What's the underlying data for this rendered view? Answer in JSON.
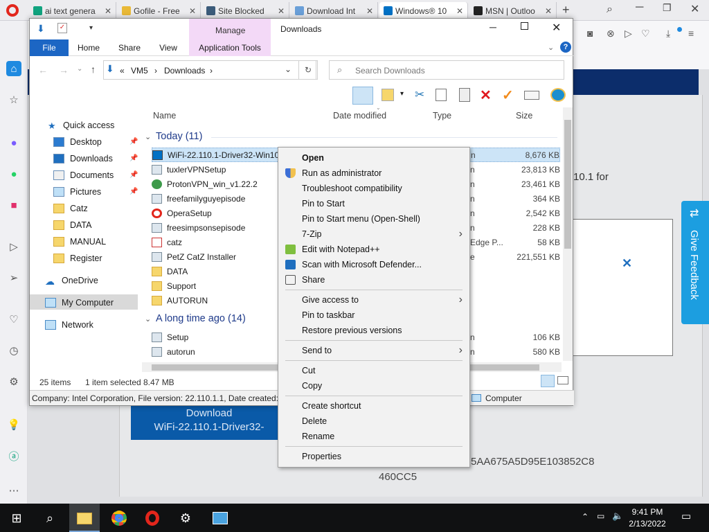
{
  "browser": {
    "tabs": [
      {
        "title": "ai text genera",
        "fav": "#11a37f"
      },
      {
        "title": "Gofile - Free",
        "fav": "#e9b937"
      },
      {
        "title": "Site Blocked",
        "fav": "#3b5b7a"
      },
      {
        "title": "Download Int",
        "fav": "#6a9fd8"
      },
      {
        "title": "Windows® 10",
        "fav": "#0071c5"
      },
      {
        "title": "MSN | Outloo",
        "fav": "#222222"
      }
    ],
    "new_tab": "+"
  },
  "page": {
    "version_frag": "10.1 for",
    "download_line1": "Download",
    "download_line2": "WiFi-22.110.1-Driver32-",
    "hash_line1": "5AA675A5D95E103852C8",
    "hash_line2": "460CC5",
    "feedback": "Give Feedback",
    "modal_close": "✕"
  },
  "explorer": {
    "title": "Downloads",
    "manage": "Manage",
    "tabs": {
      "file": "File",
      "home": "Home",
      "share": "Share",
      "view": "View",
      "app_tools": "Application Tools"
    },
    "breadcrumb": {
      "sep": "«",
      "vm": "VM5",
      "folder": "Downloads"
    },
    "search_placeholder": "Search Downloads",
    "columns": {
      "name": "Name",
      "date": "Date modified",
      "type": "Type",
      "size": "Size"
    },
    "nav": {
      "quick_access": "Quick access",
      "items": [
        "Desktop",
        "Downloads",
        "Documents",
        "Pictures",
        "Catz",
        "DATA",
        "MANUAL",
        "Register"
      ],
      "onedrive": "OneDrive",
      "computer": "My Computer",
      "network": "Network"
    },
    "groups": {
      "today": "Today (11)",
      "longago": "A long time ago (14)"
    },
    "files": [
      {
        "name": "WiFi-22.110.1-Driver32-Win10",
        "type": "n",
        "size": "8,676 KB"
      },
      {
        "name": "tuxlerVPNSetup",
        "type": "n",
        "size": "23,813 KB"
      },
      {
        "name": "ProtonVPN_win_v1.22.2",
        "type": "n",
        "size": "23,461 KB"
      },
      {
        "name": "freefamilyguyepisode",
        "type": "n",
        "size": "364 KB"
      },
      {
        "name": "OperaSetup",
        "type": "n",
        "size": "2,542 KB"
      },
      {
        "name": "freesimpsonsepisode",
        "type": "n",
        "size": "228 KB"
      },
      {
        "name": "catz",
        "type": "Edge P...",
        "size": "58 KB"
      },
      {
        "name": "PetZ CatZ Installer",
        "type": "e",
        "size": "221,551 KB"
      },
      {
        "name": "DATA",
        "type": "",
        "size": ""
      },
      {
        "name": "Support",
        "type": "",
        "size": ""
      },
      {
        "name": "AUTORUN",
        "type": "",
        "size": ""
      }
    ],
    "files_old": [
      {
        "name": "Setup",
        "type": "n",
        "size": "106 KB"
      },
      {
        "name": "autorun",
        "type": "n",
        "size": "580 KB"
      }
    ],
    "status": {
      "items": "25 items",
      "selected": "1 item selected",
      "size": "8.47 MB"
    },
    "details": "Company: Intel Corporation, File version: 22.110.1.1, Date created: 2/",
    "details_right": "Computer"
  },
  "context_menu": {
    "items": [
      {
        "label": "Open",
        "bold": true
      },
      {
        "label": "Run as administrator",
        "icon": "shield-icon"
      },
      {
        "label": "Troubleshoot compatibility"
      },
      {
        "label": "Pin to Start"
      },
      {
        "label": "Pin to Start menu (Open-Shell)"
      },
      {
        "label": "7-Zip",
        "submenu": true
      },
      {
        "label": "Edit with Notepad++",
        "icon": "notepad-icon"
      },
      {
        "label": "Scan with Microsoft Defender...",
        "icon": "defender-icon"
      },
      {
        "label": "Share",
        "icon": "share-icon"
      },
      {
        "label": "Give access to",
        "submenu": true
      },
      {
        "label": "Pin to taskbar"
      },
      {
        "label": "Restore previous versions"
      },
      {
        "label": "Send to",
        "submenu": true
      },
      {
        "label": "Cut"
      },
      {
        "label": "Copy"
      },
      {
        "label": "Create shortcut"
      },
      {
        "label": "Delete"
      },
      {
        "label": "Rename"
      },
      {
        "label": "Properties"
      }
    ]
  },
  "taskbar": {
    "time": "9:41 PM",
    "date": "2/13/2022"
  }
}
